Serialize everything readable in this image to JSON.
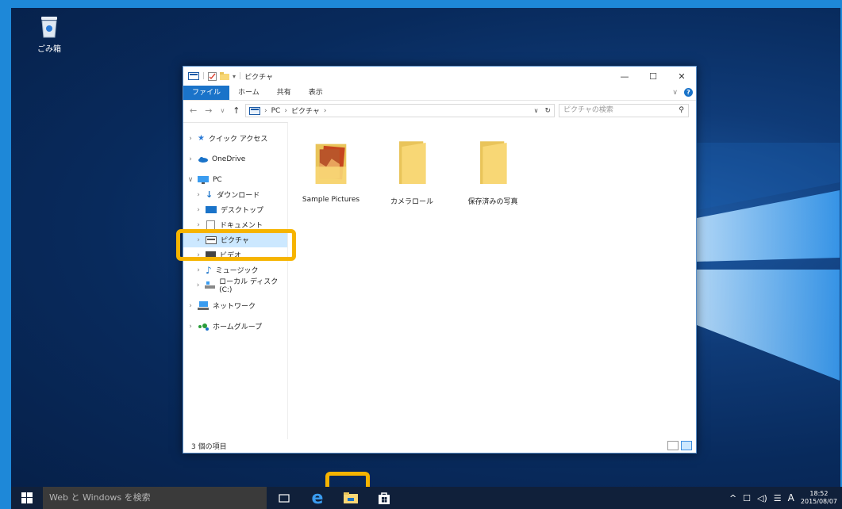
{
  "desktop": {
    "recycle_bin_label": "ごみ箱"
  },
  "window": {
    "title": "ピクチャ",
    "controls": {
      "minimize": "—",
      "maximize": "☐",
      "close": "✕"
    },
    "ribbon_tabs": [
      {
        "label": "ファイル"
      },
      {
        "label": "ホーム"
      },
      {
        "label": "共有"
      },
      {
        "label": "表示"
      }
    ],
    "address": {
      "crumbs": [
        "PC",
        "ピクチャ"
      ],
      "search_placeholder": "ピクチャの検索"
    },
    "nav_pane": [
      {
        "label": "クイック アクセス",
        "chev": ">",
        "icon": "star-icon",
        "indent": 0
      },
      {
        "label": "OneDrive",
        "chev": ">",
        "icon": "cloud-icon",
        "indent": 0
      },
      {
        "label": "PC",
        "chev": "∨",
        "icon": "pc-icon",
        "indent": 0
      },
      {
        "label": "ダウンロード",
        "chev": ">",
        "icon": "download-icon",
        "indent": 1
      },
      {
        "label": "デスクトップ",
        "chev": ">",
        "icon": "desktop-icon",
        "indent": 1
      },
      {
        "label": "ドキュメント",
        "chev": ">",
        "icon": "document-icon",
        "indent": 1
      },
      {
        "label": "ピクチャ",
        "chev": ">",
        "icon": "pictures-icon",
        "indent": 1
      },
      {
        "label": "ビデオ",
        "chev": ">",
        "icon": "video-icon",
        "indent": 1
      },
      {
        "label": "ミュージック",
        "chev": ">",
        "icon": "music-icon",
        "indent": 1
      },
      {
        "label": "ローカル ディスク (C:)",
        "chev": ">",
        "icon": "disk-icon",
        "indent": 1
      },
      {
        "label": "ネットワーク",
        "chev": ">",
        "icon": "network-icon",
        "indent": 0
      },
      {
        "label": "ホームグループ",
        "chev": ">",
        "icon": "homegroup-icon",
        "indent": 0
      }
    ],
    "selected_nav": "ピクチャ",
    "files": [
      {
        "label": "Sample Pictures",
        "type": "folder-with-picture"
      },
      {
        "label": "カメラロール",
        "type": "folder"
      },
      {
        "label": "保存済みの写真",
        "type": "folder"
      }
    ],
    "status": "3 個の項目"
  },
  "taskbar": {
    "search_placeholder": "Web と Windows を検索",
    "tray_ime": "A",
    "time": "18:52",
    "date": "2015/08/07"
  },
  "colors": {
    "accent": "#1a73c9",
    "highlight": "#f6b400",
    "selection": "#cce8ff",
    "folder": "#f8d775"
  }
}
